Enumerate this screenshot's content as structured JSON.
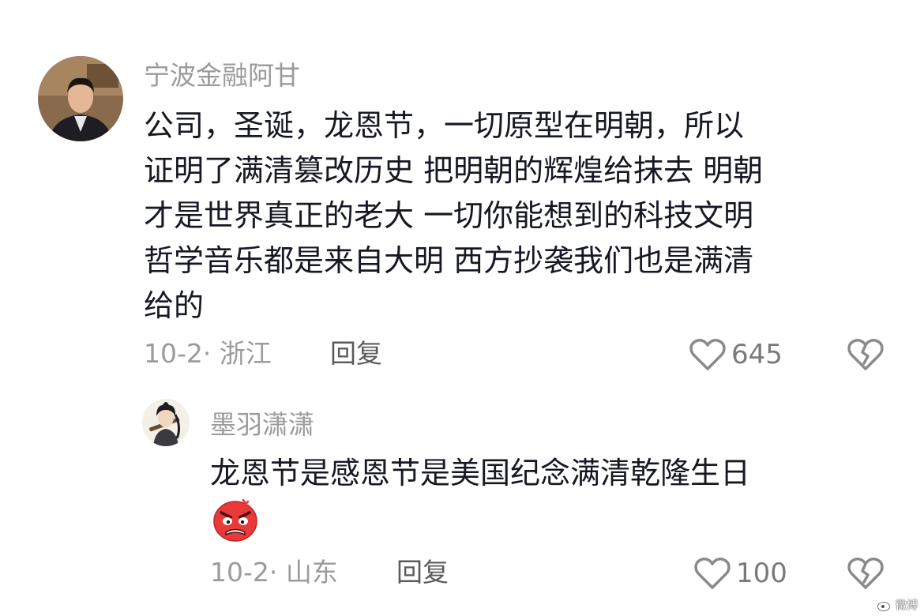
{
  "comment": {
    "username": "宁波金融阿甘",
    "lines": [
      "公司，圣诞，龙恩节，一切原型在明朝，所以",
      "证明了满清篡改历史 把明朝的辉煌给抹去 明朝",
      "才是世界真正的老大 一切你能想到的科技文明",
      "哲学音乐都是来自大明 西方抄袭我们也是满清",
      "给的"
    ],
    "meta": "10-2· 浙江",
    "reply_label": "回复",
    "like_count": "645",
    "avatar_icon": "user-avatar",
    "like_icon": "heart-outline-icon",
    "dislike_icon": "broken-heart-icon"
  },
  "reply": {
    "username": "墨羽潇潇",
    "text": "龙恩节是感恩节是美国纪念满清乾隆生日",
    "emoji": "angry-face-emoji",
    "meta": "10-2· 山东",
    "reply_label": "回复",
    "like_count": "100",
    "avatar_icon": "anime-character-avatar",
    "like_icon": "heart-outline-icon",
    "dislike_icon": "broken-heart-icon"
  },
  "watermark": {
    "text": "微博",
    "icon": "weibo-icon"
  },
  "colors": {
    "text_primary": "#161823",
    "text_secondary": "#9b9b9b",
    "reply_label": "#5a5a5a",
    "emoji_red": "#e83a3a"
  }
}
